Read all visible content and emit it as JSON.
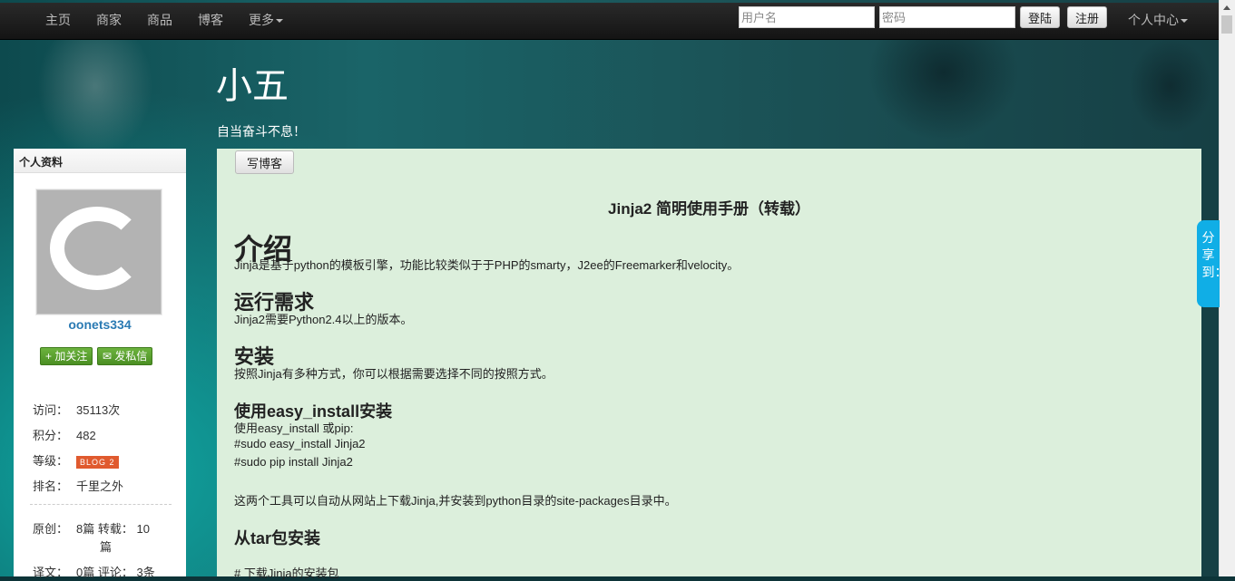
{
  "nav": {
    "items": [
      "主页",
      "商家",
      "商品",
      "博客"
    ],
    "more": "更多",
    "username_placeholder": "用户名",
    "password_placeholder": "密码",
    "login": "登陆",
    "register": "注册",
    "user_center": "个人中心"
  },
  "blog": {
    "title": "小五",
    "subtitle": "自当奋斗不息！"
  },
  "sidebar": {
    "header": "个人资料",
    "username": "oonets334",
    "follow": "加关注",
    "message": "发私信",
    "stats": {
      "visits_label": "访问：",
      "visits": "35113次",
      "points_label": "积分：",
      "points": "482",
      "level_label": "等级：",
      "level_badge": "BLOG 2",
      "rank_label": "排名：",
      "rank": "千里之外",
      "original_label": "原创：",
      "original": "8篇",
      "repost_label": "转载：",
      "repost": "10",
      "repost_unit": "篇",
      "translation_label": "译文：",
      "translation": "0篇",
      "comments_label": "评论：",
      "comments": "3条"
    }
  },
  "main": {
    "write_blog": "写博客",
    "article_title": "Jinja2 简明使用手册（转载）",
    "sections": {
      "intro_h": "介绍",
      "intro_p": "Jinja是基于python的模板引擎，功能比较类似于于PHP的smarty，J2ee的Freemarker和velocity。",
      "req_h": "运行需求",
      "req_p": "Jinja2需要Python2.4以上的版本。",
      "install_h": "安装",
      "install_p": "按照Jinja有多种方式，你可以根据需要选择不同的按照方式。",
      "easy_h": "使用easy_install安装",
      "easy_p1": "使用easy_install 或pip:",
      "easy_p2": "#sudo easy_install Jinja2",
      "easy_p3": "#sudo pip install Jinja2",
      "easy_p4": "这两个工具可以自动从网站上下载Jinja,并安装到python目录的site-packages目录中。",
      "tar_h": "从tar包安装",
      "tar_p1": "# 下载Jinja的安装包"
    }
  },
  "share": "分享到：",
  "icons": [
    "plus-icon",
    "mail-icon",
    "caret-down-icon"
  ]
}
